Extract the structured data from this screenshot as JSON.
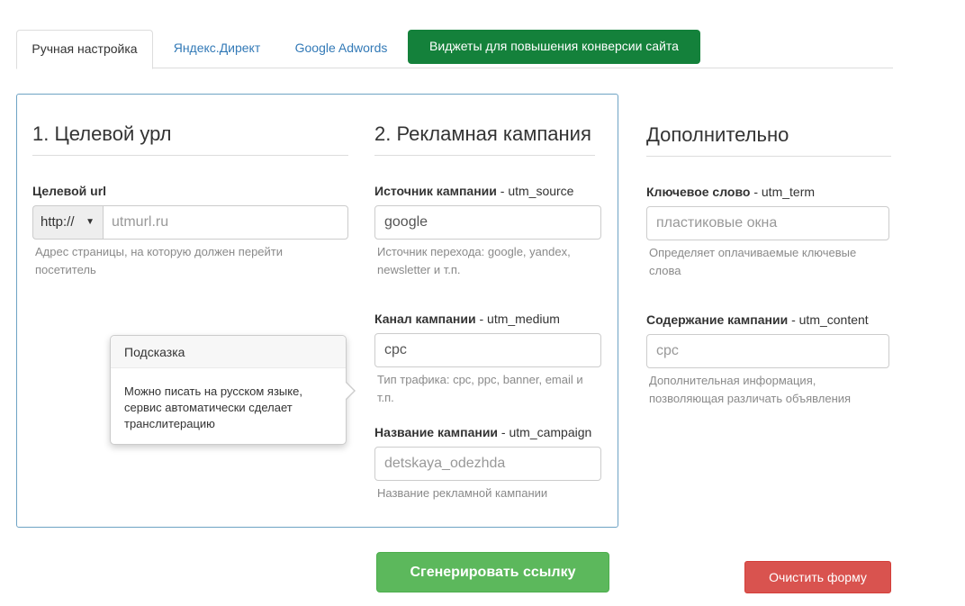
{
  "tabs": [
    {
      "label": "Ручная настройка"
    },
    {
      "label": "Яндекс.Директ"
    },
    {
      "label": "Google Adwords"
    },
    {
      "label": "Виджеты для повышения конверсии сайта"
    }
  ],
  "sections": {
    "target": {
      "title": "1. Целевой урл",
      "field_label": "Целевой url",
      "protocol": "http://",
      "url_placeholder": "utmurl.ru",
      "help": "Адрес страницы, на которую должен перейти посетитель"
    },
    "campaign": {
      "title": "2. Рекламная кампания",
      "source": {
        "label_bold": "Источник кампании",
        "label_param": " - utm_source",
        "value": "google",
        "help": "Источник перехода: google, yandex, newsletter и т.п."
      },
      "medium": {
        "label_bold": "Канал кампании",
        "label_param": " - utm_medium",
        "value": "cpc",
        "help": "Тип трафика: cpc, ppc, banner, email и т.п."
      },
      "name": {
        "label_bold": "Название кампании",
        "label_param": " - utm_campaign",
        "placeholder": "detskaya_odezhda",
        "help": "Название рекламной кампании"
      }
    },
    "extra": {
      "title": "Дополнительно",
      "term": {
        "label_bold": "Ключевое слово",
        "label_param": " - utm_term",
        "placeholder": "пластиковые окна",
        "help": "Определяет оплачиваемые ключевые слова"
      },
      "content": {
        "label_bold": "Содержание кампании",
        "label_param": " - utm_content",
        "placeholder": "cpc",
        "help": "Дополнительная информация, позволяющая различать объявления"
      }
    }
  },
  "popover": {
    "title": "Подсказка",
    "body": "Можно писать на русском языке, сервис автоматически сделает транслитерацию"
  },
  "buttons": {
    "generate": "Сгенерировать ссылку",
    "clear": "Очистить форму"
  },
  "colors": {
    "tab_green": "#14813b",
    "generate_button": "#5cb85c",
    "clear_button": "#d9534f",
    "panel_border": "#6ea3c4",
    "link": "#337ab7"
  }
}
